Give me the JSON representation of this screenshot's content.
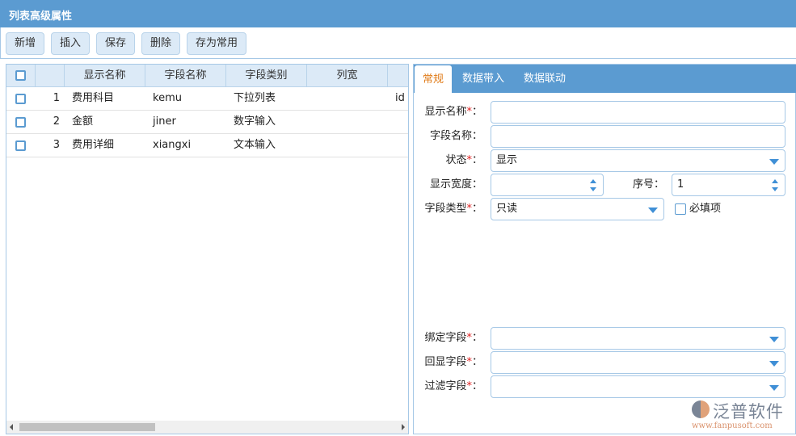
{
  "window": {
    "title": "列表高级属性"
  },
  "toolbar": {
    "buttons": [
      "新增",
      "插入",
      "保存",
      "删除",
      "存为常用"
    ]
  },
  "grid": {
    "columns": [
      "显示名称",
      "字段名称",
      "字段类别",
      "列宽"
    ],
    "rows": [
      {
        "no": "1",
        "display": "费用科目",
        "field": "kemu",
        "type": "下拉列表",
        "width": "",
        "extra": "id"
      },
      {
        "no": "2",
        "display": "金额",
        "field": "jiner",
        "type": "数字输入",
        "width": "",
        "extra": ""
      },
      {
        "no": "3",
        "display": "费用详细",
        "field": "xiangxi",
        "type": "文本输入",
        "width": "",
        "extra": ""
      }
    ]
  },
  "tabs": [
    "常规",
    "数据带入",
    "数据联动"
  ],
  "form": {
    "display_name": {
      "label": "显示名称",
      "value": ""
    },
    "field_name": {
      "label": "字段名称：",
      "value": ""
    },
    "status": {
      "label": "状态",
      "value": "显示"
    },
    "display_width": {
      "label": "显示宽度：",
      "value": ""
    },
    "order": {
      "label": "序号：",
      "value": "1"
    },
    "field_type": {
      "label": "字段类型",
      "value": "只读"
    },
    "required": {
      "label": "必填项",
      "checked": false
    },
    "bind_field": {
      "label": "绑定字段",
      "value": ""
    },
    "echo_field": {
      "label": "回显字段",
      "value": ""
    },
    "filter_field": {
      "label": "过滤字段",
      "value": ""
    },
    "req_mark": "*",
    "colon": "："
  },
  "watermark": {
    "brand": "泛普软件",
    "url": "www.fanpusoft.com"
  },
  "colors": {
    "accent": "#5b9bd1",
    "active_tab": "#e07b18"
  }
}
